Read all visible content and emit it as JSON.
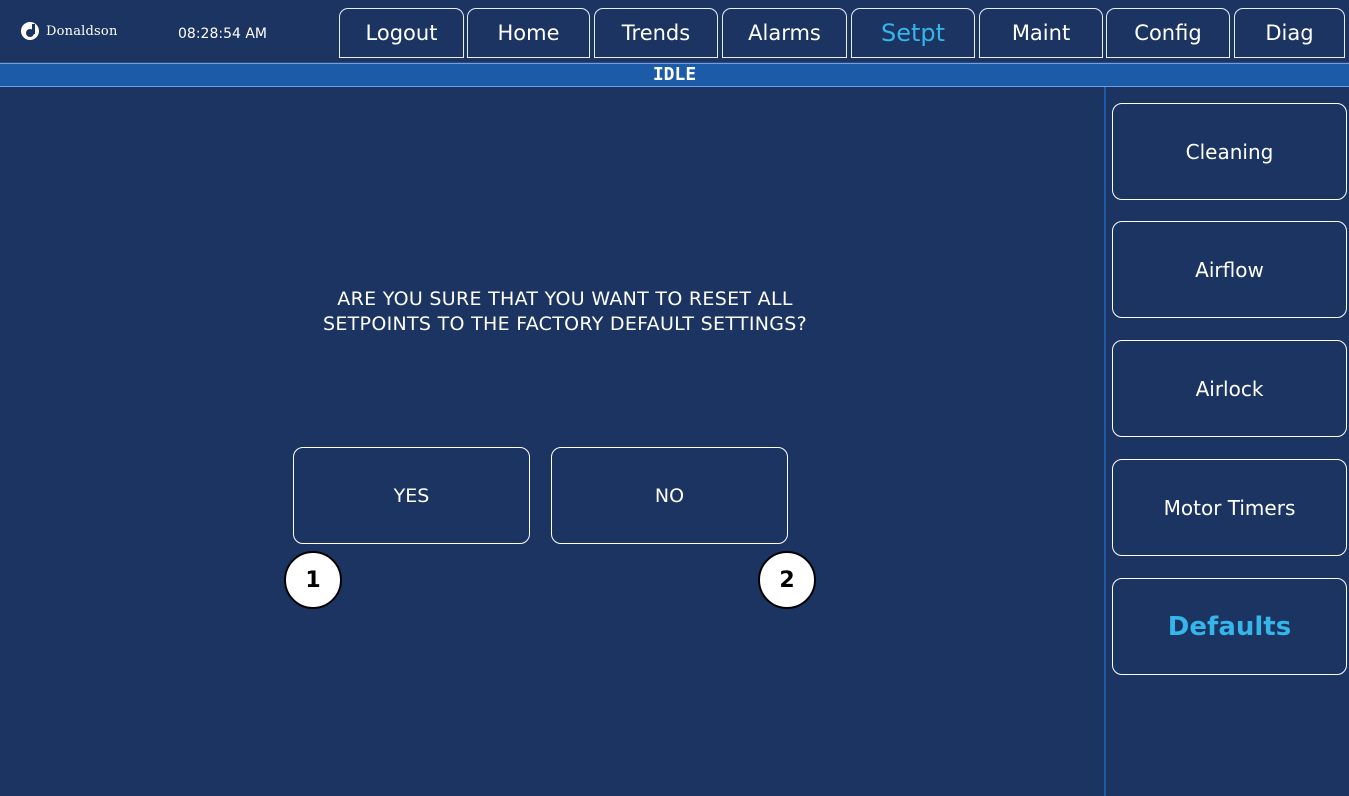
{
  "header": {
    "logo_text": "Donaldson",
    "time": "08:28:54 AM",
    "nav": [
      {
        "label": "Logout"
      },
      {
        "label": "Home"
      },
      {
        "label": "Trends"
      },
      {
        "label": "Alarms"
      },
      {
        "label": "Setpt",
        "active": true
      },
      {
        "label": "Maint"
      },
      {
        "label": "Config"
      },
      {
        "label": "Diag"
      }
    ]
  },
  "status": {
    "text": "IDLE"
  },
  "dialog": {
    "line1": "ARE YOU SURE THAT YOU WANT TO RESET ALL",
    "line2": "SETPOINTS TO THE FACTORY DEFAULT SETTINGS?",
    "yes_label": "YES",
    "no_label": "NO"
  },
  "callouts": [
    "1",
    "2"
  ],
  "sidebar": {
    "items": [
      {
        "label": "Cleaning"
      },
      {
        "label": "Airflow"
      },
      {
        "label": "Airlock"
      },
      {
        "label": "Motor Timers"
      },
      {
        "label": "Defaults",
        "active": true
      }
    ]
  },
  "colors": {
    "background": "#1b3461",
    "status_bar": "#1c5ba8",
    "active_text": "#35b5ea",
    "border": "#ffffff"
  }
}
